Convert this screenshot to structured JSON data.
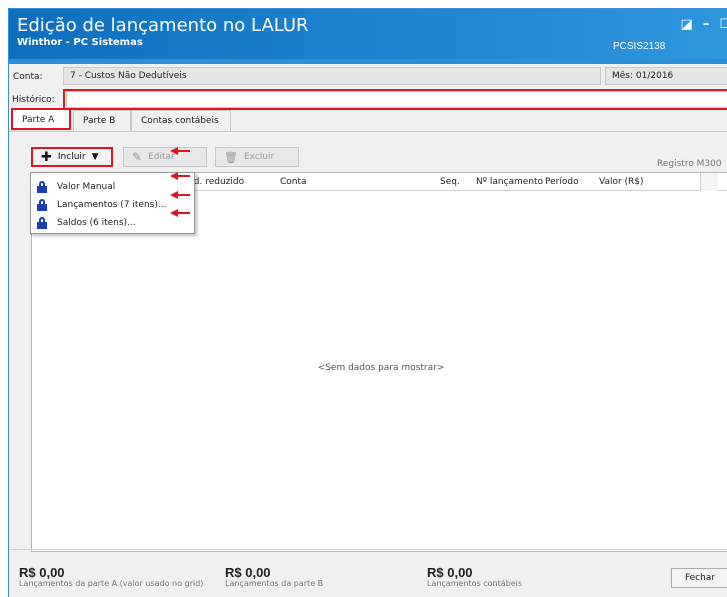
{
  "window": {
    "title": "Edição de lançamento no LALUR",
    "subtitle": "Winthor - PC Sistemas",
    "code": "PCSIS2138"
  },
  "form": {
    "conta_label": "Conta:",
    "conta_value": "7 - Custos Não Dedutíveis",
    "mes_value": "Mês: 01/2016",
    "historico_label": "Histórico:",
    "historico_value": ""
  },
  "tabs": [
    {
      "label": "Parte A"
    },
    {
      "label": "Parte B"
    },
    {
      "label": "Contas contábeis"
    }
  ],
  "toolbar": {
    "incluir_label": "Incluir",
    "editar_label": "Editar",
    "excluir_label": "Excluir",
    "registro": "Registro M300"
  },
  "grid": {
    "columns": [
      "Cód. reduzido",
      "Conta",
      "Seq.",
      "Nº lançamento",
      "Período",
      "Valor (R$)"
    ],
    "empty_text": "<Sem dados para mostrar>"
  },
  "menu": {
    "items": [
      {
        "label": "Valor Manual"
      },
      {
        "label": "Lançamentos (7 itens)..."
      },
      {
        "label": "Saldos (6 itens)..."
      }
    ]
  },
  "footer": {
    "totals": [
      {
        "value": "R$ 0,00",
        "caption": "Lançamentos da parte A (valor usado no grid)"
      },
      {
        "value": "R$ 0,00",
        "caption": "Lançamentos da parte B"
      },
      {
        "value": "R$ 0,00",
        "caption": "Lançamentos contábeis"
      }
    ],
    "fechar_label": "Fechar"
  },
  "colors": {
    "titlebar": "#1f86d2",
    "highlight": "#e0141e",
    "lock_icon": "#1a3fb0"
  }
}
